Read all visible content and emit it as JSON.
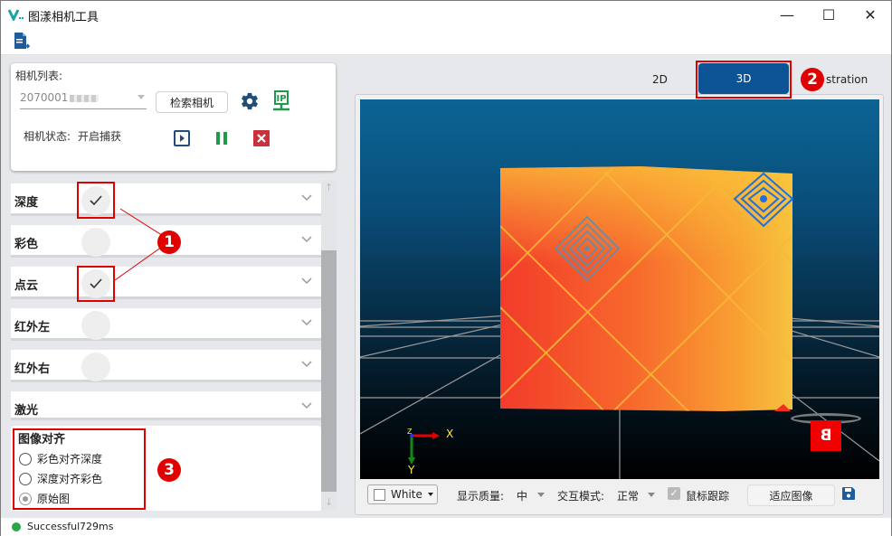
{
  "window": {
    "title": "图漾相机工具",
    "controls": {
      "minimize": "—",
      "maximize": "☐",
      "close": "✕"
    }
  },
  "toolbar": {
    "export_icon": "export-file-icon"
  },
  "camera": {
    "list_label": "相机列表:",
    "selected_serial": "2070001",
    "search_button": "检索相机",
    "status_label": "相机状态:",
    "status_value": "开启捕获",
    "icons": [
      "gear-icon",
      "ip-config-icon",
      "play-icon",
      "pause-icon",
      "stop-icon"
    ]
  },
  "streams": [
    {
      "label": "深度",
      "enabled": true
    },
    {
      "label": "彩色",
      "enabled": false
    },
    {
      "label": "点云",
      "enabled": true
    },
    {
      "label": "红外左",
      "enabled": false
    },
    {
      "label": "红外右",
      "enabled": false
    },
    {
      "label": "激光",
      "enabled": null
    }
  ],
  "alignment": {
    "title": "图像对齐",
    "options": [
      {
        "label": "彩色对齐深度",
        "selected": false
      },
      {
        "label": "深度对齐彩色",
        "selected": false
      },
      {
        "label": "原始图",
        "selected": true
      }
    ]
  },
  "status_bar": {
    "status": "Successful",
    "elapsed": "729ms"
  },
  "view_tabs": [
    {
      "label": "2D",
      "active": false
    },
    {
      "label": "3D",
      "active": true
    },
    {
      "label": "stration",
      "active": false
    }
  ],
  "viewport": {
    "axes": {
      "x": "X",
      "y": "Y",
      "z": "Z"
    },
    "orientation_cube_face": "B"
  },
  "view_toolbar": {
    "bg_color": "White",
    "quality_label": "显示质量:",
    "quality_value": "中",
    "interaction_label": "交互模式:",
    "interaction_value": "正常",
    "mouse_track_label": "鼠标跟踪",
    "mouse_track_checked": true,
    "fit_button": "适应图像"
  },
  "annotations": [
    "1",
    "2",
    "3"
  ],
  "colors": {
    "accent": "#0b5394",
    "annotation": "#e00000",
    "success": "#27a745",
    "play": "#1f4e79",
    "pause": "#1e9a4a",
    "stop": "#c8323c"
  }
}
